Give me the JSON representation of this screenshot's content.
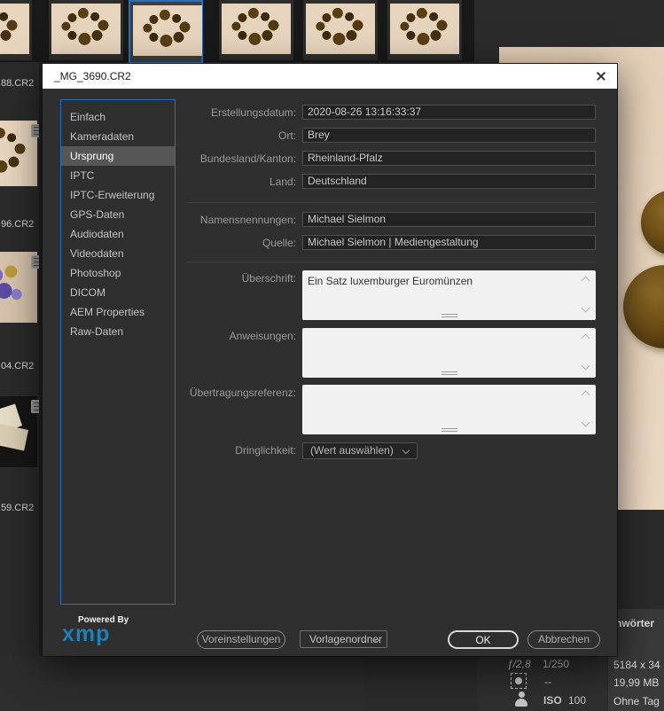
{
  "dialog": {
    "title": "_MG_3690.CR2",
    "sidebar": {
      "items": [
        "Einfach",
        "Kameradaten",
        "Ursprung",
        "IPTC",
        "IPTC-Erweiterung",
        "GPS-Daten",
        "Audiodaten",
        "Videodaten",
        "Photoshop",
        "DICOM",
        "AEM Properties",
        "Raw-Daten"
      ],
      "selected": "Ursprung"
    },
    "fields": {
      "creation_date": {
        "label": "Erstellungsdatum:",
        "value": "2020-08-26 13:16:33:37"
      },
      "city": {
        "label": "Ort:",
        "value": "Brey"
      },
      "state": {
        "label": "Bundesland/Kanton:",
        "value": "Rheinland-Pfalz"
      },
      "country": {
        "label": "Land:",
        "value": "Deutschland"
      },
      "credit": {
        "label": "Namensnennungen:",
        "value": "Michael Sielmon"
      },
      "source": {
        "label": "Quelle:",
        "value": "Michael Sielmon | Mediengestaltung"
      },
      "headline": {
        "label": "Überschrift:",
        "value": "Ein Satz luxemburger Euromünzen"
      },
      "instructions": {
        "label": "Anweisungen:",
        "value": ""
      },
      "transmission_ref": {
        "label": "Übertragungsreferenz:",
        "value": ""
      },
      "urgency": {
        "label": "Dringlichkeit:",
        "value": "(Wert auswählen)"
      }
    },
    "footer": {
      "powered_by": "Powered By",
      "logo_text": "xmp",
      "presets_button": "Voreinstellungen",
      "template_folder_button": "Vorlagenordner",
      "ok_button": "OK",
      "cancel_button": "Abbrechen"
    }
  },
  "left_panel": {
    "filenames": [
      "88.CR2",
      "96.CR2",
      "04.CR2",
      "59.CR2"
    ]
  },
  "metadata_panel": {
    "keywords_header": "hwörter",
    "aperture": "ƒ/2,8",
    "shutter": "1/250",
    "metering_value": "--",
    "iso_label": "ISO",
    "iso_value": "100",
    "dimensions": "5184 x 34",
    "file_size": "19,99 MB",
    "tag_status": "Ohne Tag"
  },
  "colors": {
    "accent_blue": "#2a6fc0",
    "logo_blue": "#1f7fb8",
    "preview_beige": "#e6d2bc"
  }
}
